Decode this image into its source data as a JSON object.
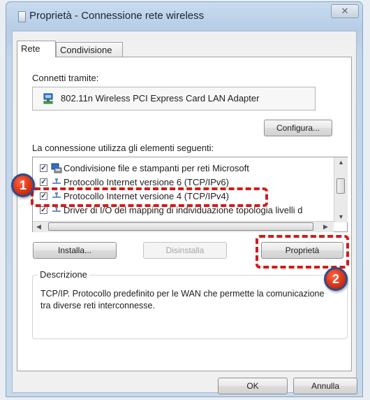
{
  "window": {
    "title": "Proprietà - Connessione rete wireless",
    "close_glyph": "✕"
  },
  "tabs": [
    {
      "label": "Rete",
      "active": true
    },
    {
      "label": "Condivisione",
      "active": false
    }
  ],
  "connect_via": {
    "label": "Connetti tramite:",
    "adapter": "802.11n Wireless PCI Express Card LAN Adapter",
    "icon": "network-adapter-icon"
  },
  "configure_button": "Configura...",
  "items_label": "La connessione utilizza gli elementi seguenti:",
  "items": [
    {
      "label": "Condivisione file e stampanti per reti Microsoft",
      "checked": true,
      "icon": "share-printer-icon"
    },
    {
      "label": "Protocollo Internet versione 6 (TCP/IPv6)",
      "checked": true,
      "icon": "protocol-icon"
    },
    {
      "label": "Protocollo Internet versione 4 (TCP/IPv4)",
      "checked": true,
      "icon": "protocol-icon"
    },
    {
      "label": "Driver di I/O del mapping di individuazione topologia livelli d",
      "checked": true,
      "icon": "protocol-icon"
    }
  ],
  "buttons": {
    "install": "Installa...",
    "uninstall": "Disinstalla",
    "properties": "Proprietà"
  },
  "description": {
    "title": "Descrizione",
    "text": "TCP/IP. Protocollo predefinito per le WAN che permette la comunicazione tra diverse reti interconnesse."
  },
  "footer": {
    "ok": "OK",
    "cancel": "Annulla"
  },
  "annotations": {
    "step1": "1",
    "step2": "2",
    "color": "#d21b1b"
  }
}
